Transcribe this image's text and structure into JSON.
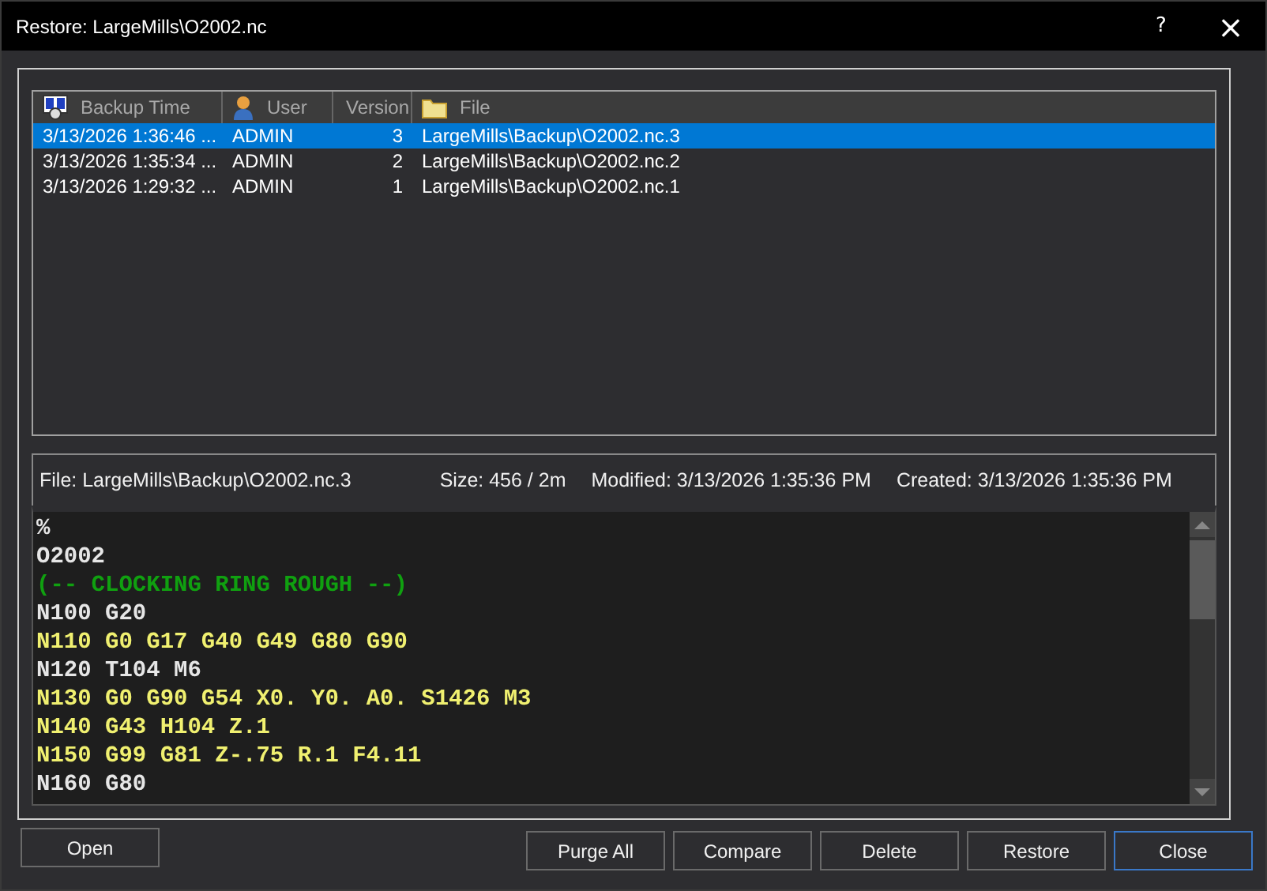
{
  "window": {
    "title": "Restore: LargeMills\\O2002.nc",
    "help": "?",
    "close": "×"
  },
  "table": {
    "columns": [
      {
        "label": "Backup Time",
        "kind": "time"
      },
      {
        "label": "User",
        "kind": "user"
      },
      {
        "label": "Version",
        "kind": "number"
      },
      {
        "label": "File",
        "kind": "file"
      }
    ],
    "rows": [
      {
        "selected": true,
        "cells": [
          "3/13/2026 1:36:46 ...",
          "ADMIN",
          "3",
          "LargeMills\\Backup\\O2002.nc.3"
        ]
      },
      {
        "selected": false,
        "cells": [
          "3/13/2026 1:35:34 ...",
          "ADMIN",
          "2",
          "LargeMills\\Backup\\O2002.nc.2"
        ]
      },
      {
        "selected": false,
        "cells": [
          "3/13/2026 1:29:32 ...",
          "ADMIN",
          "1",
          "LargeMills\\Backup\\O2002.nc.1"
        ]
      }
    ]
  },
  "info": {
    "file": "File: LargeMills\\Backup\\O2002.nc.3",
    "size": "Size: 456 / 2m",
    "modified": "Modified: 3/13/2026 1:35:36 PM",
    "created": "Created: 3/13/2026 1:35:36 PM"
  },
  "code_lines": [
    {
      "kind": "plain",
      "text": "%"
    },
    {
      "kind": "plain",
      "text": "O2002"
    },
    {
      "kind": "comment",
      "text": "(-- CLOCKING RING ROUGH --)"
    },
    {
      "kind": "plain",
      "text": "N100 G20"
    },
    {
      "kind": "motion",
      "text": "N110 G0 G17 G40 G49 G80 G90"
    },
    {
      "kind": "plain",
      "text": "N120 T104 M6"
    },
    {
      "kind": "motion",
      "text": "N130 G0 G90 G54 X0. Y0. A0. S1426 M3"
    },
    {
      "kind": "motion",
      "text": "N140 G43 H104 Z.1"
    },
    {
      "kind": "motion",
      "text": "N150 G99 G81 Z-.75 R.1 F4.11"
    },
    {
      "kind": "plain",
      "text": "N160 G80"
    }
  ],
  "buttons_left": [
    {
      "label": "Open",
      "default": false
    }
  ],
  "buttons_right": [
    {
      "label": "Purge All",
      "default": false
    },
    {
      "label": "Compare",
      "default": false
    },
    {
      "label": "Delete",
      "default": false
    },
    {
      "label": "Restore",
      "default": false
    },
    {
      "label": "Close",
      "default": true
    }
  ]
}
